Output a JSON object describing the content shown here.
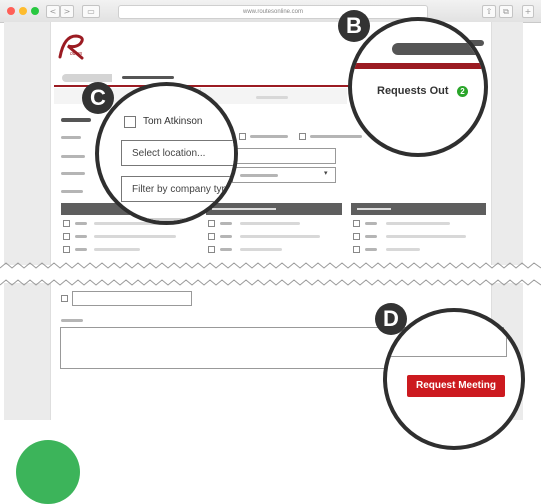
{
  "browser": {
    "url": "www.routesonline.com",
    "nav_back": "<",
    "nav_forward": ">",
    "traffic_colors": [
      "#ff5f57",
      "#febc2e",
      "#28c840"
    ]
  },
  "callouts": {
    "b": {
      "badge": "B",
      "label": "Requests Out",
      "count": "2"
    },
    "c": {
      "badge": "C",
      "name": "Tom Atkinson",
      "location_placeholder": "Select location...",
      "company_placeholder": "Filter by company typ"
    },
    "d": {
      "badge": "D",
      "button_label": "Request Meeting"
    }
  },
  "colors": {
    "brand_red": "#9b1b22",
    "button_red": "#cc1a1f",
    "count_green": "#2aa52a",
    "bottom_circle": "#3cb45a"
  }
}
